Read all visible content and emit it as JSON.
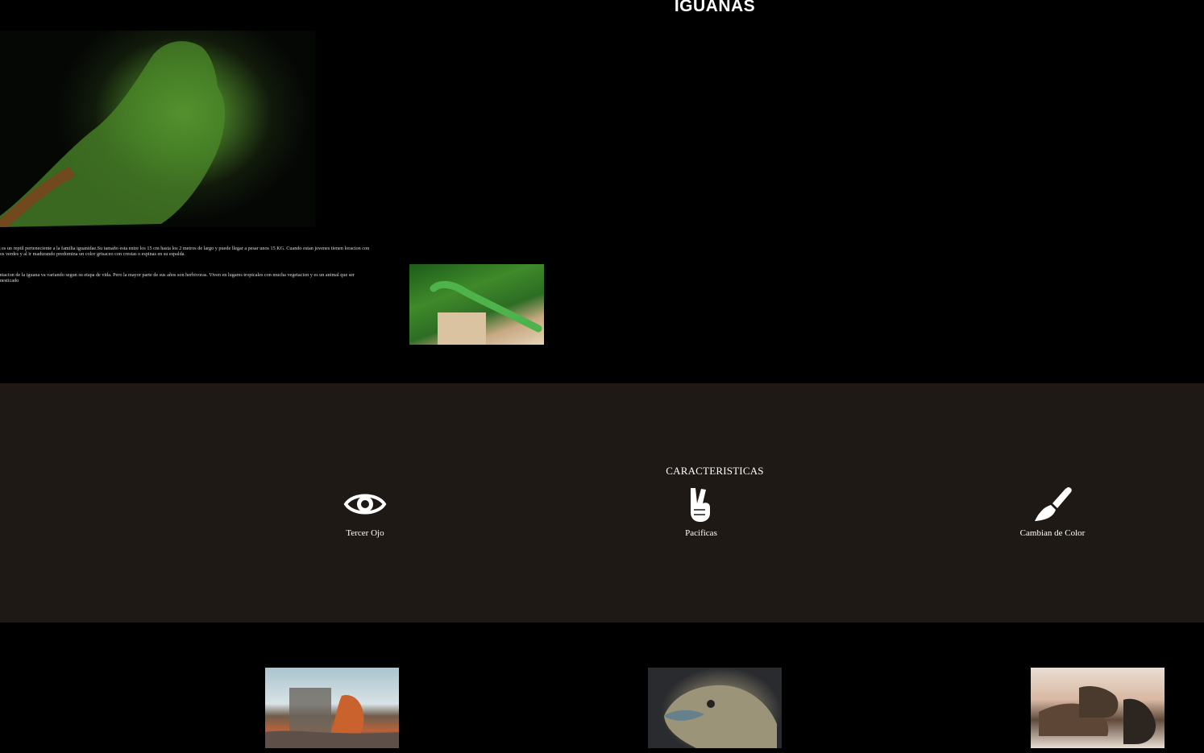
{
  "header": {
    "title": "IGUANAS"
  },
  "intro": {
    "paragraph_1": "ana es un reptil perteneciente a la familia iguanidae.Su tamaño esta entre los 15 cm hasta los 2 metros de largo y puede llegar a pesar unos 15 KG. Cuando estan jovenes tienen loracion con tonos verdes y al ir madurando predomina un color grisaceo con crestas o espinas en su espalda.",
    "paragraph_2": "mentacion de la iguana va variando segun su etapa de vida. Pero la mayor parte de sus años son herbivoras. Viven en lugares tropicales con mucha vegetacion y es un animal que ser domesticado"
  },
  "features": {
    "heading": "CARACTERISTICAS",
    "items": [
      {
        "label": "Tercer Ojo",
        "icon": "eye-icon"
      },
      {
        "label": "Pacificas",
        "icon": "peace-hand-icon"
      },
      {
        "label": "Cambian de Color",
        "icon": "paint-brush-icon"
      }
    ]
  },
  "colors": {
    "page_bg": "#000000",
    "features_bg": "#1e1915",
    "text": "#ffffff"
  }
}
